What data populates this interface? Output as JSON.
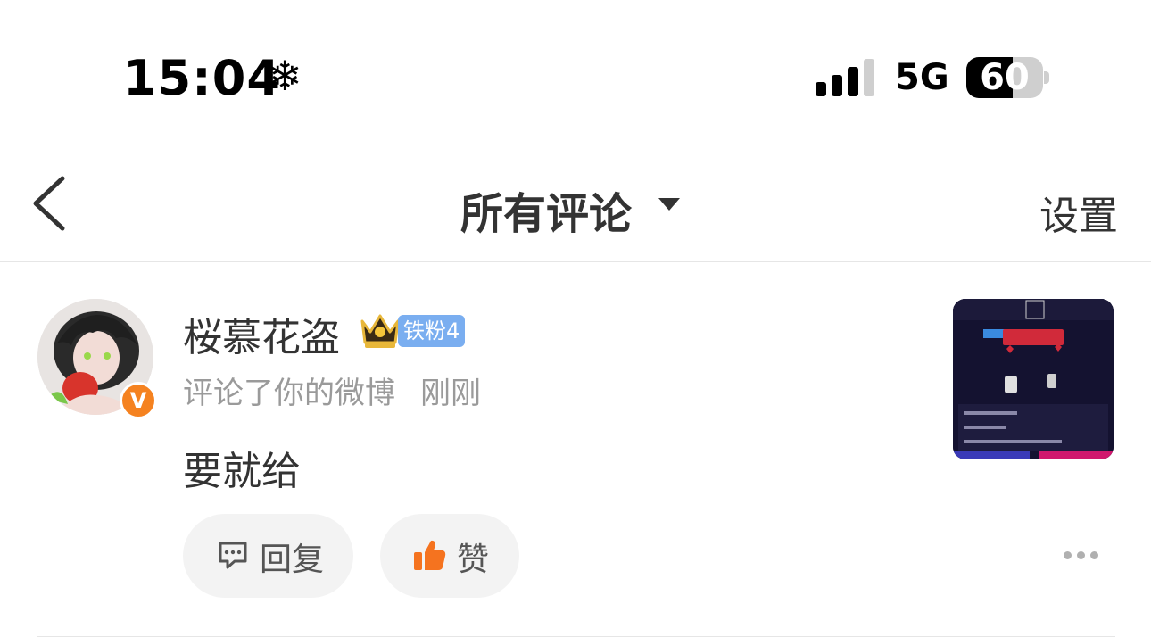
{
  "status_bar": {
    "time": "15:04",
    "mode_icon": "snowflake-icon",
    "signal_bars_filled": 3,
    "signal_bars_total": 4,
    "network": "5G",
    "battery_percent": "60"
  },
  "nav": {
    "back_icon": "chevron-left-icon",
    "title": "所有评论",
    "dropdown_icon": "caret-down-icon",
    "settings_label": "设置"
  },
  "comment": {
    "username": "桜慕花盗",
    "avatar_icon": "avatar-image",
    "verified_icon": "v-verified-icon",
    "verified_text": "V",
    "crown_icon": "crown-icon",
    "fan_badge": "铁粉4",
    "action_text": "评论了你的微博",
    "time": "刚刚",
    "text": "要就给",
    "thumbnail_icon": "post-thumbnail-image",
    "reply_label": "回复",
    "reply_icon": "comment-icon",
    "like_label": "赞",
    "like_icon": "thumbs-up-icon",
    "more_icon": "more-dots-icon"
  },
  "colors": {
    "verified": "#f58220",
    "fan_badge": "#7aaef0",
    "like": "#f5731f",
    "meta_text": "#9a9a9a"
  }
}
